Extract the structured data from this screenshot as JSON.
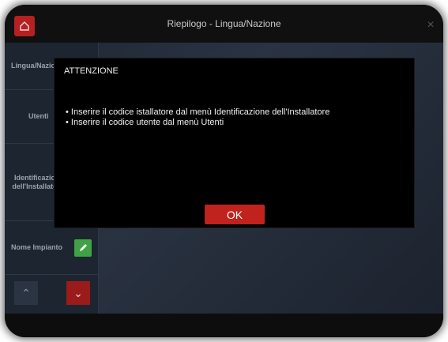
{
  "window": {
    "title": "Riepilogo - Lingua/Nazione",
    "close_symbol": "×"
  },
  "sidebar": {
    "items": [
      {
        "label": "Lingua/Nazio"
      },
      {
        "label": "Utenti"
      },
      {
        "label": "Identificazio dell'Installato"
      },
      {
        "label": "Nome Impianto"
      }
    ],
    "edit_icon": "pencil-icon",
    "nav_up_symbol": "⌃",
    "nav_down_symbol": "⌄"
  },
  "dialog": {
    "title": "ATTENZIONE",
    "messages": [
      "Inserire il codice istallatore dal menù Identificazione dell'Installatore",
      "Inserire il codice utente dal menù Utenti"
    ],
    "ok_label": "OK"
  },
  "colors": {
    "accent_red": "#c0221d",
    "edit_green": "#3fa244",
    "dialog_bg": "#000000",
    "screen_bg": "#1d2530"
  }
}
